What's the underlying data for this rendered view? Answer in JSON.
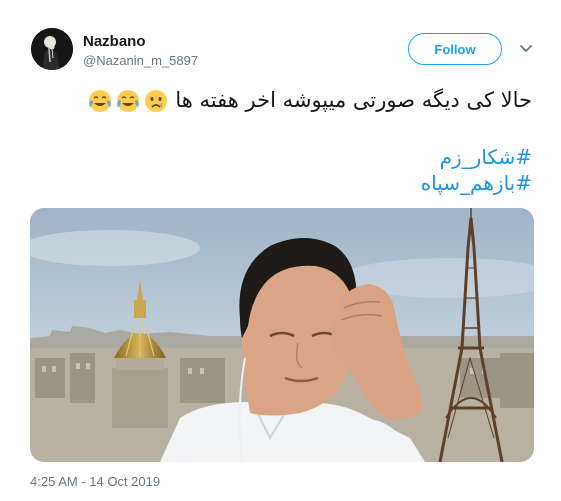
{
  "user": {
    "display_name": "Nazbano",
    "handle": "@Nazanin_m_5897"
  },
  "follow_button": {
    "label": "Follow"
  },
  "icons": {
    "avatar": "avatar-image",
    "more": "chevron-down-icon",
    "emojis": [
      "face-with-tears-of-joy",
      "face-with-tears-of-joy",
      "crying-face"
    ]
  },
  "tweet": {
    "text": "حالا کی دیگه صورتی میپوشه اخر هفته ها",
    "hashtags": [
      "#شکار_زم",
      "#بازهم_سپاه"
    ]
  },
  "timestamp": "4:25 AM - 14 Oct 2019",
  "colors": {
    "accent": "#1da1f2",
    "link": "#1b95e0",
    "secondary_text": "#657786"
  }
}
